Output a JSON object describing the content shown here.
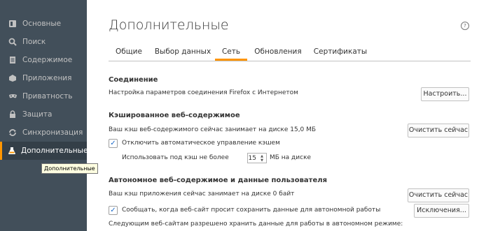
{
  "sidebar": {
    "items": [
      {
        "label": "Основные",
        "icon": "general-icon"
      },
      {
        "label": "Поиск",
        "icon": "search-icon"
      },
      {
        "label": "Содержимое",
        "icon": "content-icon"
      },
      {
        "label": "Приложения",
        "icon": "applications-icon"
      },
      {
        "label": "Приватность",
        "icon": "privacy-icon"
      },
      {
        "label": "Защита",
        "icon": "lock-icon"
      },
      {
        "label": "Синхронизация",
        "icon": "sync-icon"
      },
      {
        "label": "Дополнительные",
        "icon": "advanced-icon",
        "active": true
      }
    ],
    "tooltip": "Дополнительные"
  },
  "header": {
    "title": "Дополнительные",
    "help": "?"
  },
  "tabs": [
    {
      "label": "Общие"
    },
    {
      "label": "Выбор данных"
    },
    {
      "label": "Сеть",
      "active": true
    },
    {
      "label": "Обновления"
    },
    {
      "label": "Сертификаты"
    }
  ],
  "connection": {
    "title": "Соединение",
    "description": "Настройка параметров соединения Firefox с Интернетом",
    "button": "Настроить..."
  },
  "cache": {
    "title": "Кэшированное веб-содержимое",
    "status": "Ваш кэш веб-содержимого сейчас занимает на диске 15,0 МБ",
    "clear_button": "Очистить сейчас",
    "override_label": "Отключить автоматическое управление кэшем",
    "override_checked": true,
    "limit_prefix": "Использовать под кэш не более",
    "limit_value": "15",
    "limit_suffix": "МБ на диске"
  },
  "offline": {
    "title": "Автономное веб-содержимое и данные пользователя",
    "status": "Ваш кэш приложения сейчас занимает на диске 0 байт",
    "clear_button": "Очистить сейчас",
    "notify_label": "Сообщать, когда веб-сайт просит сохранить данные для автономной работы",
    "notify_checked": true,
    "exceptions_button": "Исключения...",
    "allowed_sites_label": "Следующим веб-сайтам разрешено хранить данные для работы в автономном режиме:"
  },
  "colors": {
    "sidebar": "#424f5a",
    "accent": "#ff9500",
    "checkbox": "#1b6ac9"
  }
}
